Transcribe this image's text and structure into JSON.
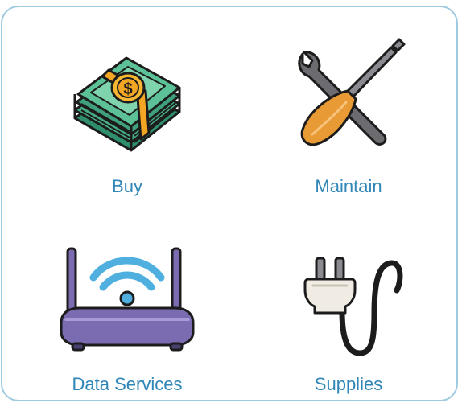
{
  "menu": {
    "items": [
      {
        "label": "Buy",
        "icon": "money-stack-icon"
      },
      {
        "label": "Maintain",
        "icon": "wrench-screwdriver-icon"
      },
      {
        "label": "Data Services",
        "icon": "wifi-router-icon"
      },
      {
        "label": "Supplies",
        "icon": "power-plug-icon"
      }
    ]
  },
  "colors": {
    "label": "#2f86b7",
    "border": "#9ec9df",
    "money": "#3fa07e",
    "money_band": "#f2a623",
    "router": "#7b6bb0",
    "wifi": "#4fb0e0",
    "tool_metal": "#6b6b70",
    "handle": "#e89a34",
    "plug": "#f0ece4"
  }
}
